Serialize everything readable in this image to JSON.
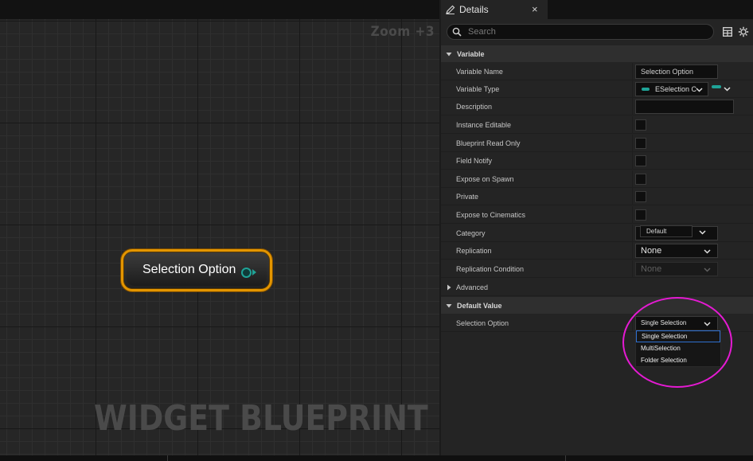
{
  "graph": {
    "zoom_label": "Zoom +3",
    "watermark": "WIDGET BLUEPRINT",
    "node": {
      "label": "Selection Option",
      "pin_color": "#1fa397",
      "border_color": "#e39500"
    }
  },
  "details": {
    "tab": {
      "label": "Details",
      "icon": "pencil-icon",
      "close": "×"
    },
    "search": {
      "placeholder": "Search",
      "value": ""
    },
    "toolbar": {
      "table_icon": "table-view-icon",
      "settings_icon": "gear-icon"
    },
    "variable_section": {
      "title": "Variable",
      "rows": {
        "variable_name": {
          "label": "Variable Name",
          "value": "Selection Option"
        },
        "variable_type": {
          "label": "Variable Type",
          "value": "ESelection C",
          "color": "#1fa397"
        },
        "description": {
          "label": "Description",
          "value": ""
        },
        "instance_editable": {
          "label": "Instance Editable",
          "checked": false
        },
        "blueprint_read_only": {
          "label": "Blueprint Read Only",
          "checked": false
        },
        "field_notify": {
          "label": "Field Notify",
          "checked": false
        },
        "expose_on_spawn": {
          "label": "Expose on Spawn",
          "checked": false
        },
        "private": {
          "label": "Private",
          "checked": false
        },
        "expose_to_cinematics": {
          "label": "Expose to Cinematics",
          "checked": false
        },
        "category": {
          "label": "Category",
          "value": "Default"
        },
        "replication": {
          "label": "Replication",
          "value": "None"
        },
        "replication_condition": {
          "label": "Replication Condition",
          "value": "None"
        }
      }
    },
    "advanced": {
      "label": "Advanced"
    },
    "default_value_section": {
      "title": "Default Value",
      "selection_option": {
        "label": "Selection Option",
        "value": "Single Selection",
        "options": [
          "Single Selection",
          "MultiSelection",
          "Folder Selection"
        ]
      }
    }
  },
  "annotation": {
    "color": "#e51ad3"
  }
}
